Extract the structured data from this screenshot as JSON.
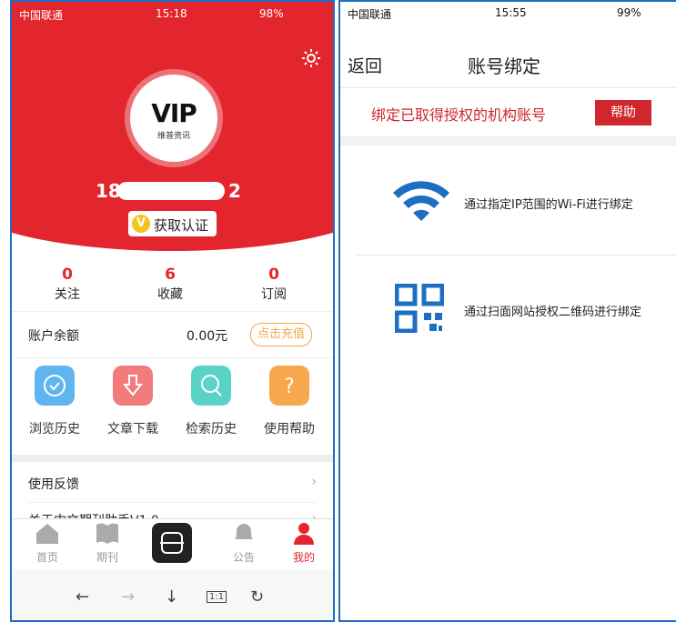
{
  "left": {
    "status": {
      "carrier": "中国联通",
      "time": "15:18",
      "battery": "98%"
    },
    "avatar": {
      "logo_text": "VIP",
      "logo_sub": "维普资讯"
    },
    "user": {
      "phone_prefix": "18",
      "phone_suffix": "2",
      "cert_label": "获取认证",
      "cert_badge": "V"
    },
    "stats": [
      {
        "num": "0",
        "label": "关注"
      },
      {
        "num": "6",
        "label": "收藏"
      },
      {
        "num": "0",
        "label": "订阅"
      }
    ],
    "balance": {
      "label": "账户余额",
      "amount": "0.00元",
      "button": "点击充值"
    },
    "tools": [
      {
        "label": "浏览历史",
        "color": "#5fb6ef",
        "icon": "clock-icon"
      },
      {
        "label": "文章下载",
        "color": "#f27b7b",
        "icon": "download-icon"
      },
      {
        "label": "检索历史",
        "color": "#59d3c7",
        "icon": "search-icon"
      },
      {
        "label": "使用帮助",
        "color": "#f7a84c",
        "icon": "question-icon"
      }
    ],
    "rows": [
      {
        "label": "使用反馈"
      },
      {
        "label": "关于中文期刊助手V1.0"
      }
    ],
    "tabbar": [
      {
        "label": "首页"
      },
      {
        "label": "期刊"
      },
      {
        "label": "公告"
      },
      {
        "label": "我的"
      }
    ],
    "browser": {
      "back": "←",
      "forward": "→",
      "download": "↓",
      "zoom": "1:1",
      "reload": "↻"
    }
  },
  "right": {
    "status": {
      "carrier": "中国联通",
      "time": "15:55",
      "battery": "99%"
    },
    "nav": {
      "back": "返回",
      "title": "账号绑定"
    },
    "notice": {
      "text": "绑定已取得授权的机构账号",
      "help": "帮助"
    },
    "options": [
      {
        "label": "通过指定IP范围的Wi-Fi进行绑定",
        "icon": "wifi-icon"
      },
      {
        "label": "通过扫面网站授权二维码进行绑定",
        "icon": "qr-code-icon"
      }
    ]
  },
  "colors": {
    "brand_red": "#e3262d",
    "link_blue": "#1e6fc2",
    "accent_orange": "#f0a94a"
  }
}
